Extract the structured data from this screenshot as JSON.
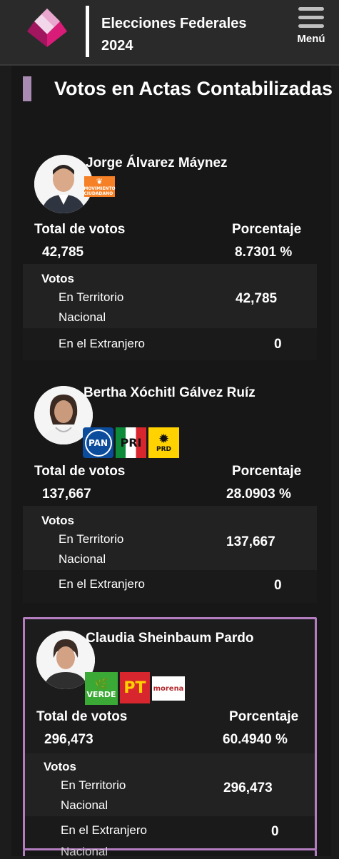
{
  "header": {
    "title": "Elecciones Federales 2024",
    "menu_label": "Menú"
  },
  "section_title": "Votos en Actas Contabilizadas",
  "labels": {
    "total_votes": "Total de votos",
    "percentage": "Porcentaje",
    "votes": "Votos",
    "national": "En Territorio Nacional",
    "abroad": "En el Extranjero",
    "peek": "Nacional"
  },
  "candidates": [
    {
      "name": "Jorge Álvarez Máynez",
      "parties": [
        "MOVIMIENTO CIUDADANO"
      ],
      "total": "42,785",
      "percentage": "8.7301 %",
      "national": "42,785",
      "abroad": "0"
    },
    {
      "name": "Bertha Xóchitl Gálvez Ruíz",
      "parties": [
        "PAN",
        "PRI",
        "PRD"
      ],
      "total": "137,667",
      "percentage": "28.0903 %",
      "national": "137,667",
      "abroad": "0"
    },
    {
      "name": "Claudia Sheinbaum Pardo",
      "parties": [
        "VERDE",
        "PT",
        "morena"
      ],
      "total": "296,473",
      "percentage": "60.4940 %",
      "national": "296,473",
      "abroad": "0"
    }
  ],
  "colors": {
    "accent": "#b47dc0",
    "header_bg": "#2a2a2a",
    "page_bg": "#1c1c1c"
  }
}
